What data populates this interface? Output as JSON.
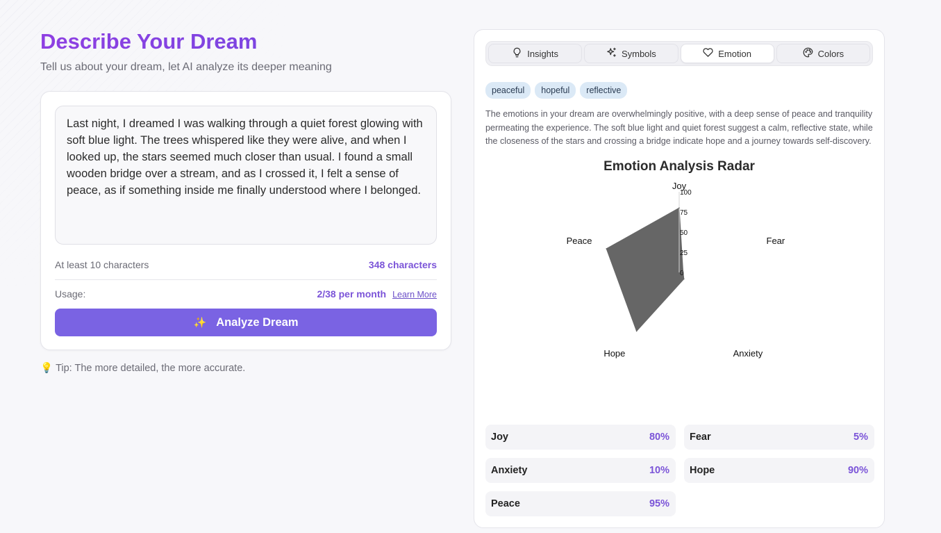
{
  "header": {
    "title": "Describe Your Dream",
    "subtitle": "Tell us about your dream, let AI analyze its deeper meaning"
  },
  "input": {
    "dream_text": "Last night, I dreamed I was walking through a quiet forest glowing with soft blue light. The trees whispered like they were alive, and when I looked up, the stars seemed much closer than usual. I found a small wooden bridge over a stream, and as I crossed it, I felt a sense of peace, as if something inside me finally understood where I belonged.",
    "min_hint": "At least 10 characters",
    "char_count": "348 characters",
    "usage_label": "Usage:",
    "usage_value": "2/38 per month",
    "learn_more": "Learn More",
    "analyze_label": "Analyze Dream",
    "analyze_icon": "✨"
  },
  "tip": {
    "icon": "💡",
    "text": "Tip: The more detailed, the more accurate."
  },
  "tabs": [
    {
      "label": "Insights",
      "icon": "lightbulb-icon",
      "active": false
    },
    {
      "label": "Symbols",
      "icon": "sparkles-icon",
      "active": false
    },
    {
      "label": "Emotion",
      "icon": "heart-icon",
      "active": true
    },
    {
      "label": "Colors",
      "icon": "palette-icon",
      "active": false
    }
  ],
  "emotion": {
    "tags": [
      "peaceful",
      "hopeful",
      "reflective"
    ],
    "description": "The emotions in your dream are overwhelmingly positive, with a deep sense of peace and tranquility permeating the experience. The soft blue light and quiet forest suggest a calm, reflective state, while the closeness of the stars and crossing a bridge indicate hope and a journey towards self-discovery.",
    "stats": [
      {
        "name": "Joy",
        "value": "80%"
      },
      {
        "name": "Fear",
        "value": "5%"
      },
      {
        "name": "Anxiety",
        "value": "10%"
      },
      {
        "name": "Hope",
        "value": "90%"
      },
      {
        "name": "Peace",
        "value": "95%"
      }
    ]
  },
  "chart_data": {
    "type": "radar",
    "title": "Emotion Analysis Radar",
    "categories": [
      "Joy",
      "Fear",
      "Anxiety",
      "Hope",
      "Peace"
    ],
    "series": [
      {
        "values": [
          80,
          5,
          10,
          90,
          95
        ]
      }
    ],
    "rlim": [
      0,
      100
    ],
    "ticks": [
      0,
      25,
      50,
      75,
      100
    ],
    "fill_color": "#666666",
    "grid": false
  }
}
